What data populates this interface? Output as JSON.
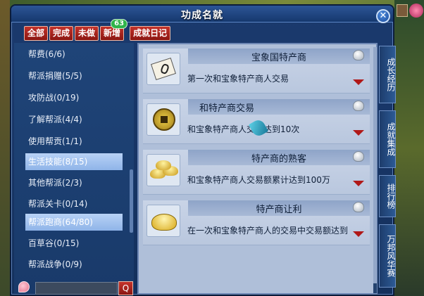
{
  "window": {
    "title": "功成名就"
  },
  "tabs": [
    {
      "label": "全部"
    },
    {
      "label": "完成"
    },
    {
      "label": "未做"
    },
    {
      "label": "新增",
      "badge": "63"
    },
    {
      "label": "成就日记"
    }
  ],
  "categories": [
    {
      "label": "帮费(6/6)"
    },
    {
      "label": "帮派捐赠(5/5)"
    },
    {
      "label": "攻防战(0/19)"
    },
    {
      "label": "了解帮派(4/4)"
    },
    {
      "label": "使用帮贡(1/1)"
    },
    {
      "label": "生活技能(8/15)"
    },
    {
      "label": "其他帮派(2/3)"
    },
    {
      "label": "帮派关卡(0/14)"
    },
    {
      "label": "帮派跑商(64/80)"
    },
    {
      "label": "百草谷(0/15)"
    },
    {
      "label": "帮派战争(0/9)"
    }
  ],
  "selected_categories": [
    "生活技能(8/15)",
    "帮派跑商(64/80)"
  ],
  "search": {
    "button_label": "Q"
  },
  "achievements": [
    {
      "name": "宝象国特产商",
      "desc": "第一次和宝象特产商人交易",
      "icon": "scroll-icon"
    },
    {
      "name": "和特产商交易",
      "desc": "和宝象特产商人交易达到10次",
      "icon": "coin-icon"
    },
    {
      "name": "特产商的熟客",
      "desc": "和宝象特产商人交易额累计达到100万",
      "icon": "gold-ingots-icon"
    },
    {
      "name": "特产商让利",
      "desc": "在一次和宝象特产商人的交易中交易额达到",
      "icon": "gold-ingot-icon"
    }
  ],
  "side_tabs": [
    {
      "label": "成长经历"
    },
    {
      "label": "成就集成"
    },
    {
      "label": "排行榜"
    },
    {
      "label": "万邦风华赛"
    }
  ],
  "colors": {
    "tab_red": "#c4332b",
    "selected_blue": "#9fc0ee",
    "panel_blue": "#193a6a",
    "card_bg": "#c5d1e5"
  }
}
